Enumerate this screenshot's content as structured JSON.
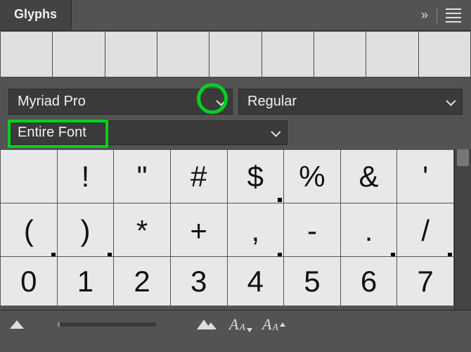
{
  "panel": {
    "title": "Glyphs"
  },
  "font": {
    "family": "Myriad Pro",
    "style": "Regular",
    "subset": "Entire Font"
  },
  "glyphs": {
    "row1": [
      "",
      "!",
      "\"",
      "#",
      "$",
      "%",
      "&",
      "'"
    ],
    "row2": [
      "(",
      ")",
      "*",
      "+",
      ",",
      "-",
      ".",
      "/"
    ],
    "row3": [
      "0",
      "1",
      "2",
      "3",
      "4",
      "5",
      "6",
      "7"
    ]
  },
  "dots": {
    "row1": [
      false,
      false,
      false,
      false,
      true,
      false,
      false,
      false
    ],
    "row2": [
      true,
      true,
      false,
      false,
      true,
      false,
      true,
      true
    ],
    "row3": [
      false,
      false,
      false,
      false,
      false,
      false,
      false,
      false
    ]
  }
}
